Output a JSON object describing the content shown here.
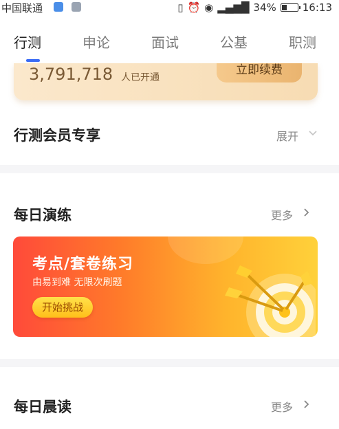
{
  "status_bar": {
    "carrier": "中国联通",
    "battery_percent": "34%",
    "battery_level": 0.34,
    "time": "16:13"
  },
  "tabs": [
    {
      "label": "行测",
      "active": true
    },
    {
      "label": "申论",
      "active": false
    },
    {
      "label": "面试",
      "active": false
    },
    {
      "label": "公基",
      "active": false
    },
    {
      "label": "职测",
      "active": false
    }
  ],
  "vip_card": {
    "member_count": "3,791,718",
    "member_label": "人已开通",
    "cta_label": "立即续费"
  },
  "member_section": {
    "title": "行测会员专享",
    "expand_label": "展开"
  },
  "daily_practice": {
    "title": "每日演练",
    "more_label": "更多",
    "banner": {
      "title": "考点/套卷练习",
      "subtitle": "由易到难  无限次刷题",
      "button_label": "开始挑战"
    }
  },
  "morning_reading": {
    "title": "每日晨读",
    "more_label": "更多"
  },
  "colors": {
    "accent": "#3b6cf5",
    "gold": "#eab46f",
    "banner_start": "#ff4a3a",
    "banner_end": "#ffd13a"
  },
  "icons": [
    "image-icon",
    "gallery-icon",
    "vibrate-icon",
    "alarm-icon",
    "eye-icon",
    "signal-icon",
    "battery-icon",
    "chevron-down-icon",
    "chevron-right-icon",
    "target-arrows-icon"
  ]
}
